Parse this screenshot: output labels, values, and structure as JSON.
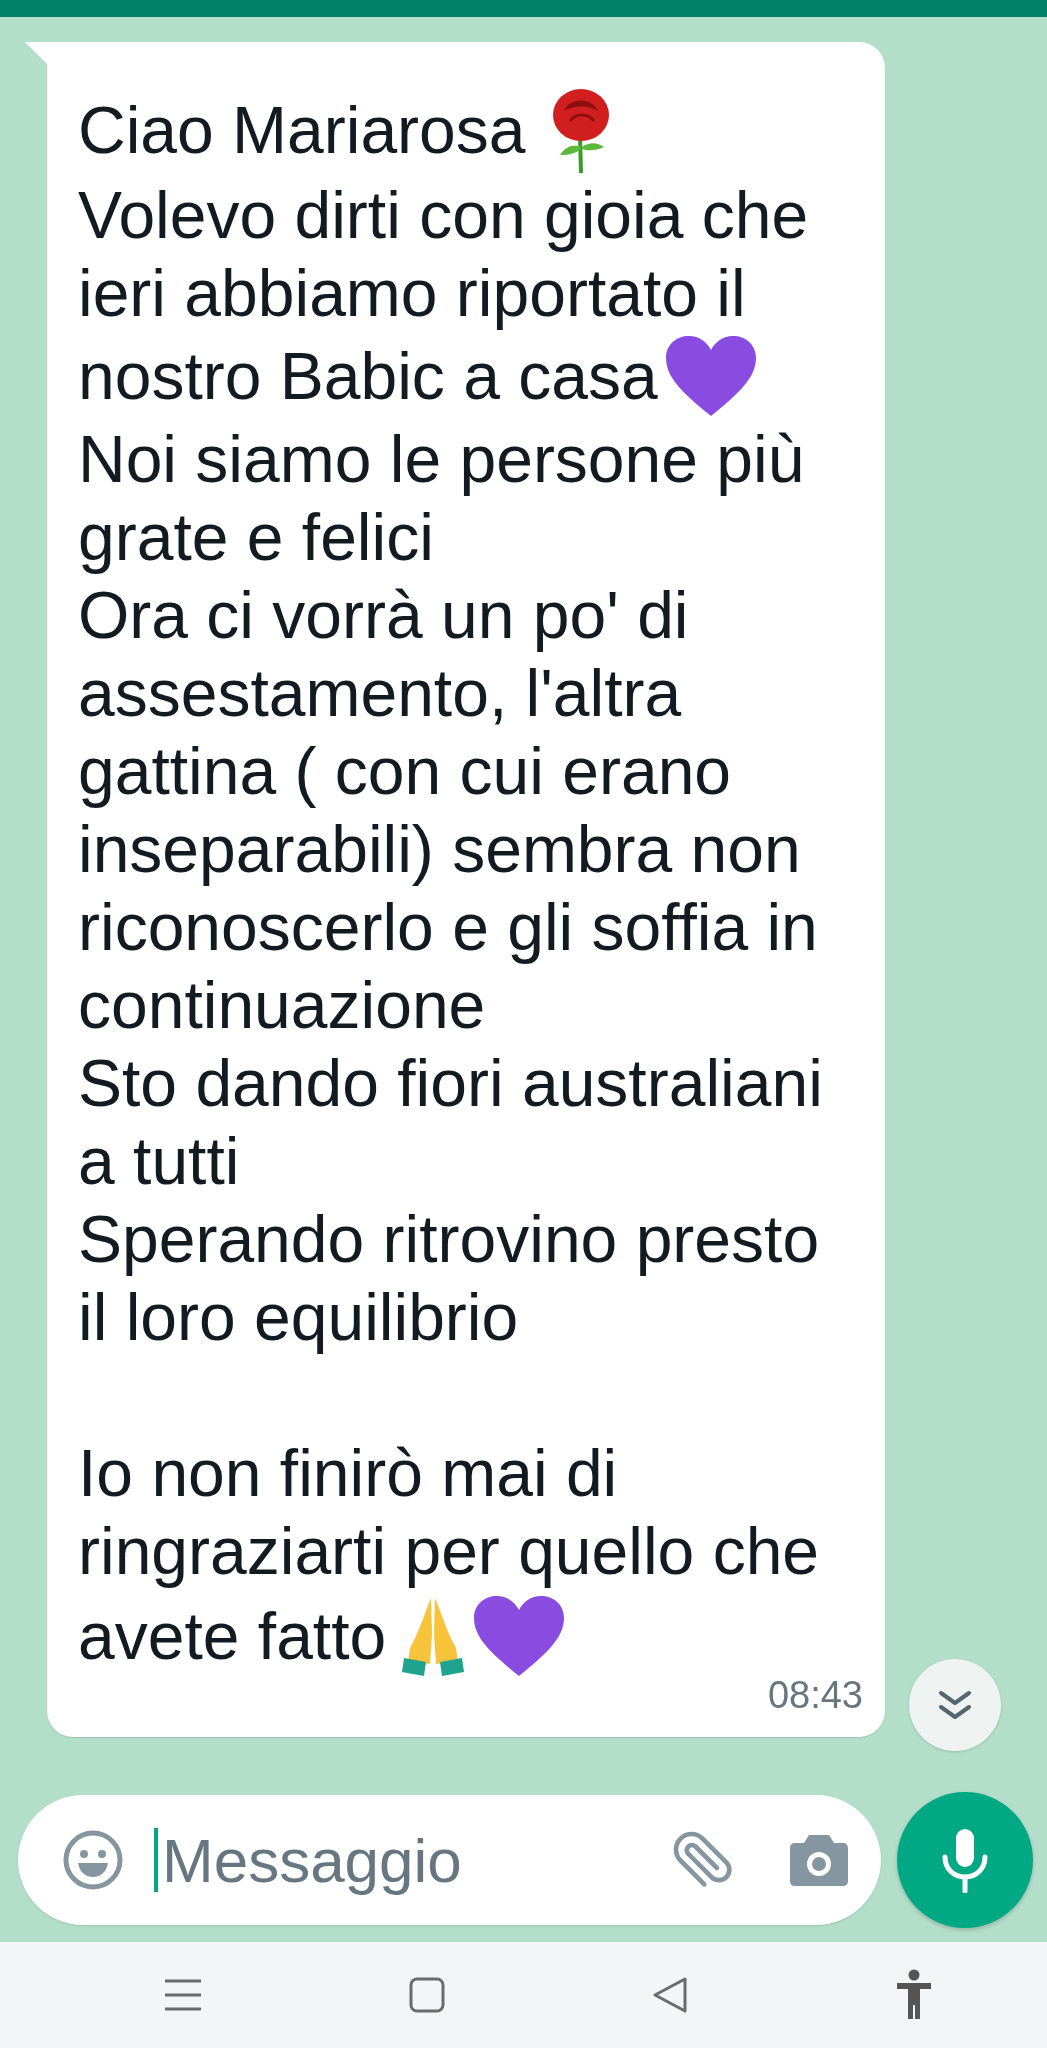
{
  "message": {
    "paragraphs": [
      [
        {
          "text": "Ciao Mariarosa",
          "emoji": [
            {
              "kind": "rose"
            }
          ]
        },
        {
          "text": "Volevo dirti con gioia che"
        },
        {
          "text": "ieri abbiamo riportato il"
        },
        {
          "text": "nostro Babic a casa",
          "emoji": [
            {
              "kind": "heart"
            }
          ]
        },
        {
          "text": "Noi siamo le persone più"
        },
        {
          "text": "grate e felici"
        },
        {
          "text": "Ora ci vorrà un po' di"
        },
        {
          "text": "assestamento, l'altra"
        },
        {
          "text": "gattina ( con cui erano"
        },
        {
          "text": "inseparabili) sembra non"
        },
        {
          "text": "riconoscerlo e gli soffia in"
        },
        {
          "text": "continuazione"
        },
        {
          "text": "Sto dando fiori australiani"
        },
        {
          "text": "a tutti"
        },
        {
          "text": "Sperando ritrovino presto"
        },
        {
          "text": "il loro equilibrio"
        }
      ],
      [
        {
          "text": "Io non finirò mai di"
        },
        {
          "text": "ringraziarti per quello che"
        },
        {
          "text": "avete fatto",
          "emoji": [
            {
              "kind": "hands"
            },
            {
              "kind": "heart"
            }
          ]
        }
      ]
    ],
    "time": "08:43"
  },
  "composer": {
    "placeholder": "Messaggio"
  }
}
